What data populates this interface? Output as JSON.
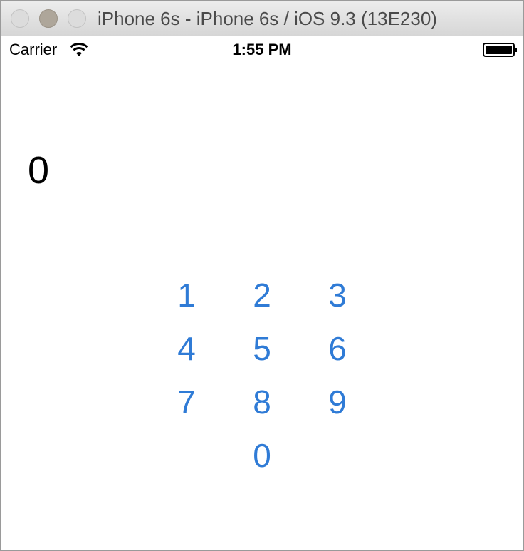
{
  "window": {
    "title": "iPhone 6s - iPhone 6s / iOS 9.3 (13E230)"
  },
  "status_bar": {
    "carrier": "Carrier",
    "time": "1:55 PM",
    "wifi_icon": "wifi-icon",
    "battery_icon": "battery-icon"
  },
  "display": {
    "value": "0"
  },
  "keypad": {
    "accent_color": "#2f7bd6",
    "keys": [
      "1",
      "2",
      "3",
      "4",
      "5",
      "6",
      "7",
      "8",
      "9",
      "0"
    ]
  }
}
